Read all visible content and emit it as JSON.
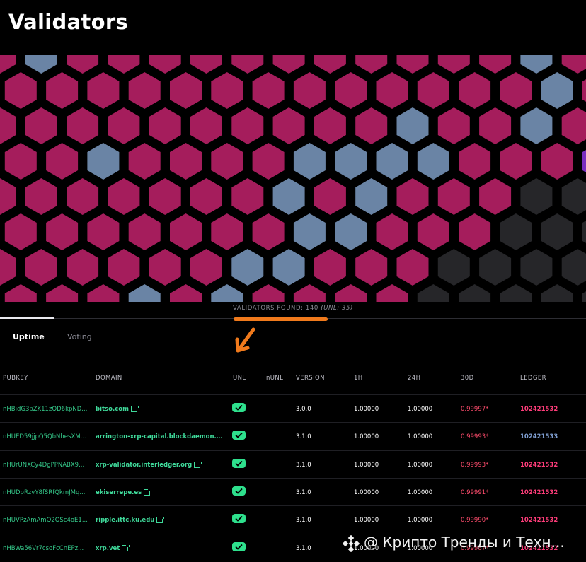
{
  "page": {
    "title": "Validators"
  },
  "summary": {
    "found_label": "VALIDATORS FOUND: 140",
    "unl_note": "(UNL: 35)"
  },
  "tabs": [
    {
      "label": "Uptime",
      "active": true
    },
    {
      "label": "Voting",
      "active": false
    }
  ],
  "table": {
    "columns": {
      "pubkey": "PUBKEY",
      "domain": "DOMAIN",
      "unl": "UNL",
      "nunl": "nUNL",
      "version": "VERSION",
      "h1": "1H",
      "h24": "24H",
      "d30": "30D",
      "ledger": "LEDGER"
    },
    "rows": [
      {
        "pubkey": "nHBidG3pZK11zQD6kpND...",
        "domain": "bitso.com",
        "unl": true,
        "version": "3.0.0",
        "h1": "1.00000",
        "h24": "1.00000",
        "d30": "0.99997*",
        "ledger": "102421532",
        "ledger_color": "#ff3d7a"
      },
      {
        "pubkey": "nHUED59jjpQ5QbNhesXM...",
        "domain": "arrington-xrp-capital.blockdaemon.c...",
        "unl": true,
        "version": "3.1.0",
        "h1": "1.00000",
        "h24": "1.00000",
        "d30": "0.99993*",
        "ledger": "102421533",
        "ledger_color": "#7f9ed0"
      },
      {
        "pubkey": "nHUrUNXCy4DgPPNABX9...",
        "domain": "xrp-validator.interledger.org",
        "unl": true,
        "version": "3.1.0",
        "h1": "1.00000",
        "h24": "1.00000",
        "d30": "0.99993*",
        "ledger": "102421532",
        "ledger_color": "#ff3d7a"
      },
      {
        "pubkey": "nHUDpRzvY8fSRfQkmJMq...",
        "domain": "ekiserrepe.es",
        "unl": true,
        "version": "3.1.0",
        "h1": "1.00000",
        "h24": "1.00000",
        "d30": "0.99991*",
        "ledger": "102421532",
        "ledger_color": "#ff3d7a"
      },
      {
        "pubkey": "nHUVPzAmAmQ2QSc4oE1...",
        "domain": "ripple.ittc.ku.edu",
        "unl": true,
        "version": "3.1.0",
        "h1": "1.00000",
        "h24": "1.00000",
        "d30": "0.99990*",
        "ledger": "102421532",
        "ledger_color": "#ff3d7a"
      },
      {
        "pubkey": "nHBWa56Vr7csoFcCnEPz...",
        "domain": "xrp.vet",
        "unl": true,
        "version": "3.1.0",
        "h1": "1.00000",
        "h24": "1.00000",
        "d30": "0.99987*",
        "ledger": "102421532",
        "ledger_color": "#ff3d7a"
      }
    ]
  },
  "hexmap": {
    "colors": {
      "magenta": "#a51d5c",
      "blue": "#6a84a5",
      "dark": "#262629",
      "purple": "#7a2ec0"
    },
    "grid": [
      "MBMMMMMMMMMMMBMB",
      "BMMMMMMMMMMMMMBM",
      "MMMMMMMMMMBMMBMM",
      "MMMBMMMMBBBBMMMP",
      "MMMMMMMBMBMMMDDD",
      "MMMMMMMMBBMMMDDD",
      "MMMMMMBBMMMDDDDD",
      "MMMMBMBMMMMDDDDD"
    ]
  },
  "watermark": {
    "text": "@ Крипто Тренды и Техн..."
  }
}
